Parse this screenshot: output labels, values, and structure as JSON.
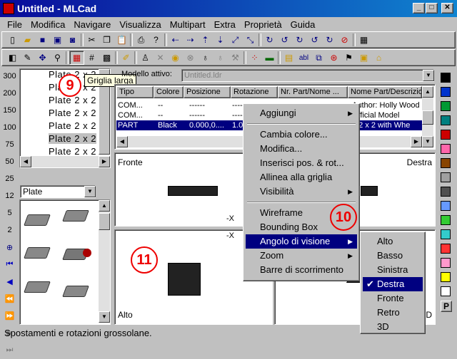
{
  "window": {
    "title": "Untitled - MLCad",
    "min": "_",
    "max": "□",
    "close": "✕"
  },
  "menu": [
    "File",
    "Modifica",
    "Navigare",
    "Visualizza",
    "Multipart",
    "Extra",
    "Proprietà",
    "Guida"
  ],
  "toolbar1_icons": [
    "new-icon",
    "open-icon",
    "save-icon",
    "save-as-icon",
    "save-all-icon",
    "cut-icon",
    "copy-icon",
    "paste-icon",
    "print-icon",
    "help-icon",
    "move-left-icon",
    "move-right-icon",
    "move-up-icon",
    "move-down-icon",
    "move-diag-icon",
    "move-back-icon",
    "rotate-x-neg-icon",
    "rotate-x-pos-icon",
    "rotate-y-neg-icon",
    "rotate-y-pos-icon",
    "rotate-z-neg-icon",
    "rotate-z-pos-icon",
    "calculator-icon"
  ],
  "toolbar2_icons": [
    "view-mode-icon",
    "edit-icon",
    "move-icon",
    "zoom-icon",
    "grid-large-icon",
    "grid-medium-icon",
    "grid-small-icon",
    "pencil-icon",
    "light-icon",
    "remove-icon",
    "color-icon",
    "no-color-icon",
    "bulb-icon",
    "bulb-off-icon",
    "tools-icon",
    "dots-icon",
    "folder-icon",
    "bricks-icon",
    "text-icon",
    "group-icon",
    "search-icon",
    "filter-icon",
    "step-icon",
    "save-view-icon"
  ],
  "tooltip": "Griglia larga",
  "badges": {
    "nine": "9",
    "ten": "10",
    "eleven": "11"
  },
  "left_tools": [
    "300",
    "200",
    "150",
    "100",
    "75",
    "50",
    "25",
    "12",
    "5",
    "2"
  ],
  "tree": {
    "items": [
      "Plate  2 x  2",
      "Plate  2 x  2",
      "Plate  2 x  2",
      "Plate  2 x  2",
      "Plate  2 x  2",
      "Plate  2 x  2",
      "Plate  2 x  2"
    ],
    "selected_index": 5
  },
  "category_combo": "Plate",
  "model": {
    "label": "Modello attivo:",
    "value": "Untitled.ldr"
  },
  "columns": [
    "Tipo",
    "Colore",
    "Posizione",
    "Rotazione",
    "Nr. Part/Nome ...",
    "Nome Part/Descrizion"
  ],
  "rows": [
    {
      "tipo": "COM...",
      "colore": "--",
      "pos": "------",
      "rot": "------",
      "nr": "",
      "nome": "Author: Holly Wood"
    },
    {
      "tipo": "COM...",
      "colore": "--",
      "pos": "------",
      "rot": "------",
      "nr": "",
      "nome": "Official Model"
    },
    {
      "tipo": "PART",
      "colore": "Black",
      "pos": "0.000,0....",
      "rot": "1.0...",
      "nr": "",
      "nome": "e  2 x  2 with Whe"
    }
  ],
  "views": {
    "front": "Fronte",
    "right": "Destra",
    "top": "Alto",
    "axis1": "-X",
    "axis2": "-X",
    "d3": "3D"
  },
  "context_menu": {
    "aggiungi": "Aggiungi",
    "cambia_colore": "Cambia colore...",
    "modifica": "Modifica...",
    "inserisci": "Inserisci pos. & rot...",
    "allinea": "Allinea alla griglia",
    "visibilita": "Visibilità",
    "wireframe": "Wireframe",
    "bounding": "Bounding Box",
    "angolo": "Angolo di visione",
    "zoom": "Zoom",
    "barre": "Barre di scorrimento"
  },
  "submenu": [
    "Alto",
    "Basso",
    "Sinistra",
    "Destra",
    "Fronte",
    "Retro",
    "3D"
  ],
  "submenu_checked": "Destra",
  "palette": [
    "#000000",
    "#0033cc",
    "#009933",
    "#008080",
    "#cc0000",
    "#ff66aa",
    "#884400",
    "#a0a0a0",
    "#505050",
    "#6699ff",
    "#33cc33",
    "#33cccc",
    "#ff3333",
    "#ff99cc",
    "#ffff00",
    "#ffffff"
  ],
  "palette_label": "P",
  "status": "Spostamenti e rotazioni grossolane.",
  "colors": {
    "title_start": "#0a0a9a",
    "title_end": "#1084d0",
    "highlight": "#000080",
    "badge": "#e00000"
  }
}
